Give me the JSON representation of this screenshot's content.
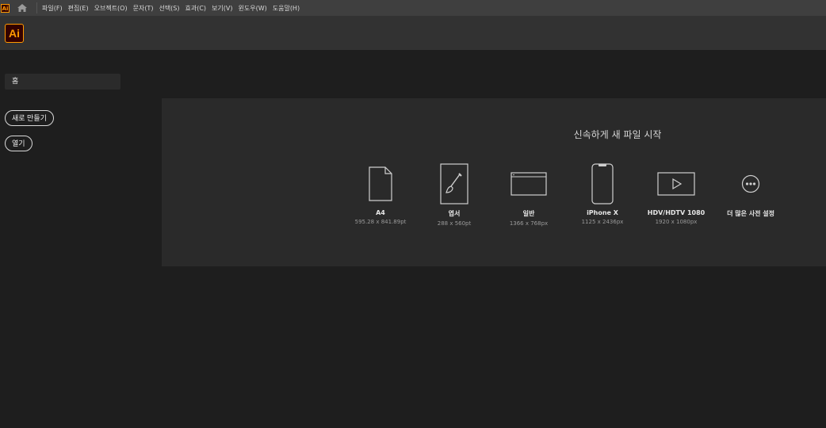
{
  "menubar": {
    "app_badge": "Ai",
    "items": [
      "파일(F)",
      "편집(E)",
      "오브젝트(O)",
      "문자(T)",
      "선택(S)",
      "효과(C)",
      "보기(V)",
      "윈도우(W)",
      "도움말(H)"
    ]
  },
  "appbar": {
    "logo": "Ai"
  },
  "sidebar": {
    "home_label": "홈",
    "new_button": "새로 만들기",
    "open_button": "열기"
  },
  "start": {
    "title": "신속하게 새 파일 시작",
    "presets": [
      {
        "name": "A4",
        "size": "595.28 x 841.89pt",
        "icon": "document-icon"
      },
      {
        "name": "엽서",
        "size": "288 x 560pt",
        "icon": "brush-icon"
      },
      {
        "name": "일반",
        "size": "1366 x 768px",
        "icon": "browser-window-icon"
      },
      {
        "name": "iPhone X",
        "size": "1125 x 2436px",
        "icon": "phone-icon"
      },
      {
        "name": "HDV/HDTV 1080",
        "size": "1920 x 1080px",
        "icon": "video-icon"
      },
      {
        "name": "더 많은 사전 설정",
        "size": "",
        "icon": "more-icon"
      }
    ]
  },
  "colors": {
    "accent": "#ff9a00",
    "logo_bg": "#330000"
  }
}
